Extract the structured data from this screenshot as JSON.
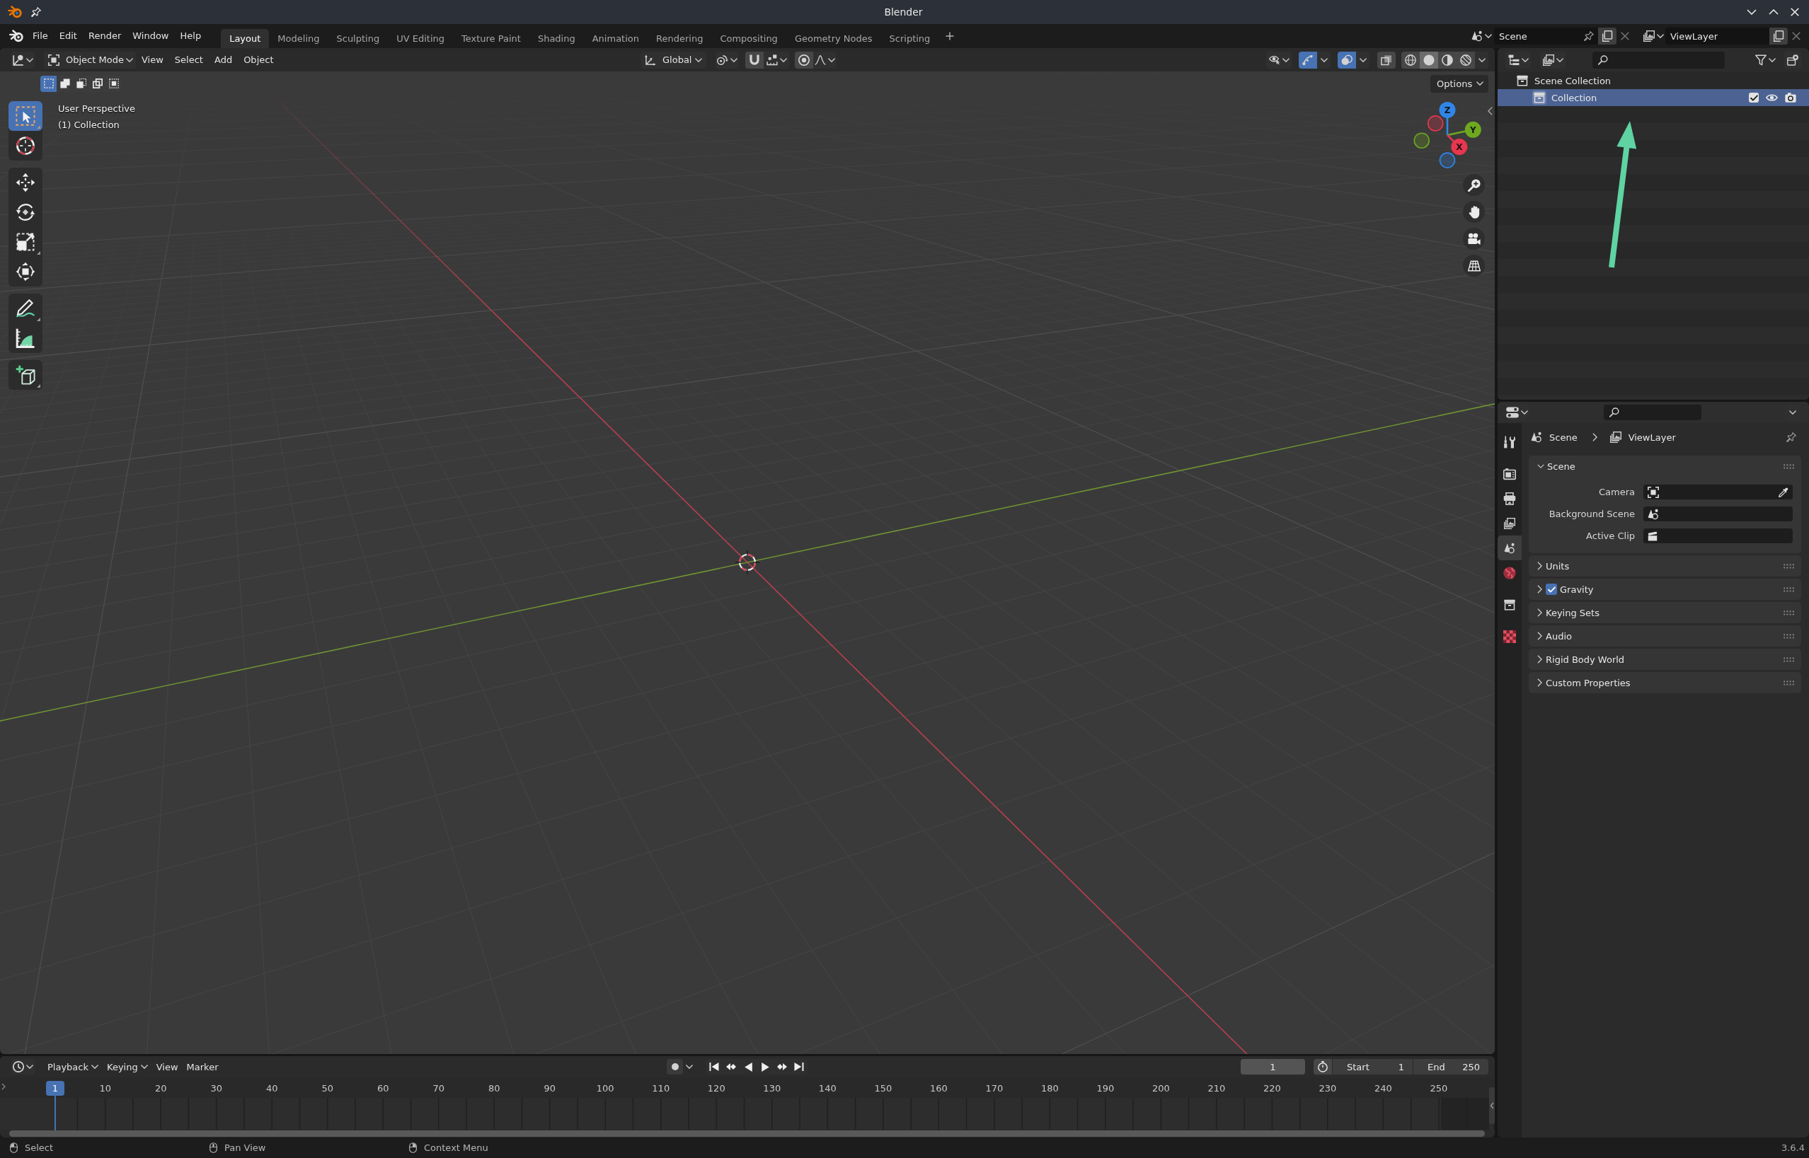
{
  "window": {
    "title": "Blender"
  },
  "top_bar": {
    "menus": [
      "File",
      "Edit",
      "Render",
      "Window",
      "Help"
    ],
    "workspace_tabs": [
      {
        "label": "Layout",
        "selected": true
      },
      {
        "label": "Modeling",
        "selected": false
      },
      {
        "label": "Sculpting",
        "selected": false
      },
      {
        "label": "UV Editing",
        "selected": false
      },
      {
        "label": "Texture Paint",
        "selected": false
      },
      {
        "label": "Shading",
        "selected": false
      },
      {
        "label": "Animation",
        "selected": false
      },
      {
        "label": "Rendering",
        "selected": false
      },
      {
        "label": "Compositing",
        "selected": false
      },
      {
        "label": "Geometry Nodes",
        "selected": false
      },
      {
        "label": "Scripting",
        "selected": false
      }
    ],
    "scene": "Scene",
    "view_layer": "ViewLayer"
  },
  "viewport": {
    "mode": "Object Mode",
    "menus": [
      "View",
      "Select",
      "Add",
      "Object"
    ],
    "orientation": "Global",
    "show_gizmos": true,
    "show_overlays": true,
    "xray": false,
    "shading": [
      {
        "kind": "wireframe",
        "selected": false
      },
      {
        "kind": "solid",
        "selected": true
      },
      {
        "kind": "material",
        "selected": false
      },
      {
        "kind": "rendered",
        "selected": false
      }
    ],
    "select_modes": [
      {
        "kind": "set",
        "selected": true
      },
      {
        "kind": "extend",
        "selected": false
      },
      {
        "kind": "subtract",
        "selected": false
      },
      {
        "kind": "difference",
        "selected": false
      },
      {
        "kind": "intersect",
        "selected": false
      }
    ],
    "options": "Options",
    "tool_groups": [
      [
        {
          "kind": "select_box",
          "selected": true,
          "flyout": true
        },
        {
          "kind": "cursor",
          "selected": false,
          "flyout": false
        }
      ],
      [
        {
          "kind": "move",
          "selected": false,
          "flyout": false
        },
        {
          "kind": "rotate",
          "selected": false,
          "flyout": false
        },
        {
          "kind": "scale",
          "selected": false,
          "flyout": true
        },
        {
          "kind": "transform",
          "selected": false,
          "flyout": false
        }
      ],
      [
        {
          "kind": "annotate",
          "selected": false,
          "flyout": true
        },
        {
          "kind": "measure",
          "selected": false,
          "flyout": false
        }
      ],
      [
        {
          "kind": "add_cube",
          "selected": false,
          "flyout": true
        }
      ]
    ],
    "info": [
      "User Perspective",
      "(1) Collection"
    ],
    "gizmo_axes": [
      {
        "label": "X",
        "color": "#e8364f"
      },
      {
        "label": "Y",
        "color": "#6ea81f"
      },
      {
        "label": "Z",
        "color": "#2f86e8"
      }
    ],
    "nav_buttons": [
      {
        "kind": "zoom"
      },
      {
        "kind": "pan"
      },
      {
        "kind": "camera"
      },
      {
        "kind": "perspective"
      }
    ]
  },
  "outliner": {
    "tree": [
      {
        "label": "Scene Collection",
        "selected": false,
        "children": [
          {
            "label": "Collection",
            "selected": true,
            "checked": true,
            "visible": true,
            "renderable": true
          }
        ]
      }
    ],
    "annotations": [
      {
        "kind": "arrow"
      }
    ]
  },
  "properties": {
    "tab_groups": [
      [
        {
          "kind": "tool",
          "selected": false
        }
      ],
      [
        {
          "kind": "render",
          "selected": false
        },
        {
          "kind": "output",
          "selected": false
        },
        {
          "kind": "view_layer",
          "selected": false
        },
        {
          "kind": "scene",
          "selected": true
        },
        {
          "kind": "world",
          "selected": false
        }
      ],
      [
        {
          "kind": "collection",
          "selected": false
        }
      ],
      [
        {
          "kind": "texture",
          "selected": false
        }
      ]
    ],
    "breadcrumb": [
      {
        "kind": "scene",
        "label": "Scene"
      },
      {
        "kind": "view_layer",
        "label": "ViewLayer"
      }
    ],
    "panels": [
      {
        "title": "Scene",
        "expanded": true,
        "fields": [
          {
            "label": "Camera",
            "kind": "camera"
          },
          {
            "label": "Background Scene",
            "kind": "scene"
          },
          {
            "label": "Active Clip",
            "kind": "clip"
          }
        ]
      },
      {
        "title": "Units",
        "expanded": false
      },
      {
        "title": "Gravity",
        "expanded": false,
        "checkbox": {
          "checked": true
        }
      },
      {
        "title": "Keying Sets",
        "expanded": false
      },
      {
        "title": "Audio",
        "expanded": false
      },
      {
        "title": "Rigid Body World",
        "expanded": false
      },
      {
        "title": "Custom Properties",
        "expanded": false
      }
    ]
  },
  "timeline": {
    "menus": [
      {
        "label": "Playback",
        "kind": "dropdown"
      },
      {
        "label": "Keying",
        "kind": "dropdown"
      },
      {
        "label": "View",
        "kind": "menu"
      },
      {
        "label": "Marker",
        "kind": "menu"
      }
    ],
    "transport": [
      {
        "kind": "jump_start"
      },
      {
        "kind": "prev_keyframe"
      },
      {
        "kind": "play_reverse"
      },
      {
        "kind": "play"
      },
      {
        "kind": "next_keyframe"
      },
      {
        "kind": "jump_end"
      }
    ],
    "current_frame": "1",
    "start": {
      "label": "Start",
      "value": "1"
    },
    "end": {
      "label": "End",
      "value": "250"
    },
    "ruler": [
      {
        "label": "1",
        "current": true
      },
      {
        "label": "10",
        "current": false
      },
      {
        "label": "20",
        "current": false
      },
      {
        "label": "30",
        "current": false
      },
      {
        "label": "40",
        "current": false
      },
      {
        "label": "50",
        "current": false
      },
      {
        "label": "60",
        "current": false
      },
      {
        "label": "70",
        "current": false
      },
      {
        "label": "80",
        "current": false
      },
      {
        "label": "90",
        "current": false
      },
      {
        "label": "100",
        "current": false
      },
      {
        "label": "110",
        "current": false
      },
      {
        "label": "120",
        "current": false
      },
      {
        "label": "130",
        "current": false
      },
      {
        "label": "140",
        "current": false
      },
      {
        "label": "150",
        "current": false
      },
      {
        "label": "160",
        "current": false
      },
      {
        "label": "170",
        "current": false
      },
      {
        "label": "180",
        "current": false
      },
      {
        "label": "190",
        "current": false
      },
      {
        "label": "200",
        "current": false
      },
      {
        "label": "210",
        "current": false
      },
      {
        "label": "220",
        "current": false
      },
      {
        "label": "230",
        "current": false
      },
      {
        "label": "240",
        "current": false
      },
      {
        "label": "250",
        "current": false
      }
    ]
  },
  "status_bar": {
    "hints": [
      {
        "kind": "left",
        "label": "Select"
      },
      {
        "kind": "middle",
        "label": "Pan View"
      },
      {
        "kind": "right",
        "label": "Context Menu"
      }
    ],
    "version": "3.6.4"
  }
}
